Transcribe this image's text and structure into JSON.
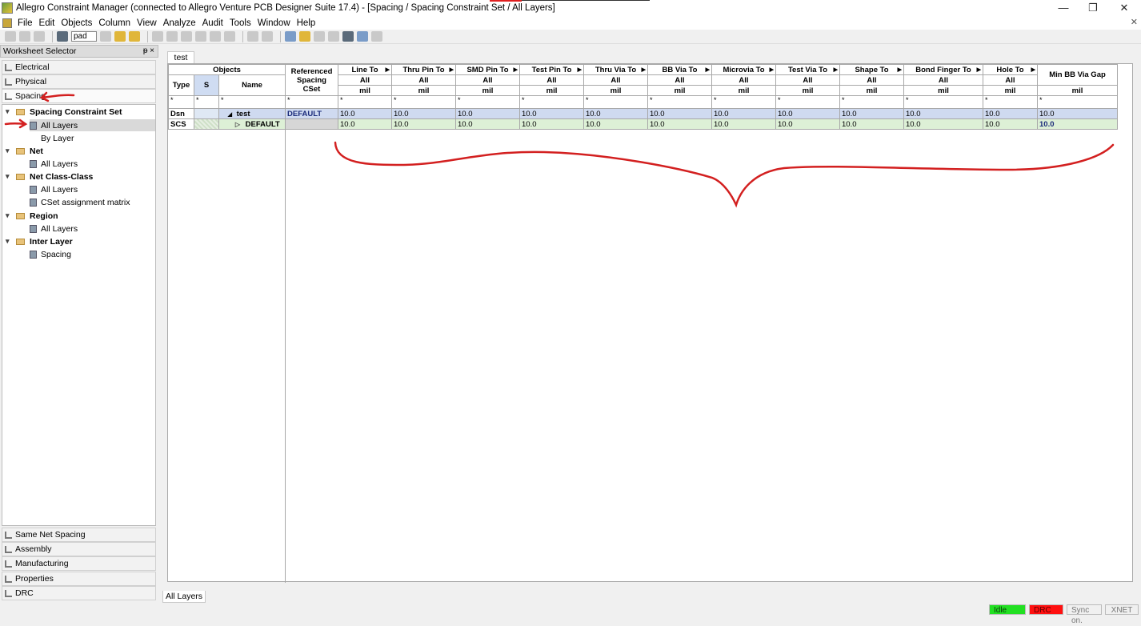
{
  "window": {
    "title": "Allegro Constraint Manager (connected to Allegro Venture PCB Designer Suite 17.4) - [Spacing / Spacing Constraint Set / All Layers]",
    "minimize": "—",
    "restore": "❐",
    "close": "✕"
  },
  "menu": {
    "items": [
      "File",
      "Edit",
      "Objects",
      "Column",
      "View",
      "Analyze",
      "Audit",
      "Tools",
      "Window",
      "Help"
    ],
    "close_doc": "✕"
  },
  "toolbar": {
    "filter_value": "pad"
  },
  "worksheet_selector": {
    "title": "Worksheet Selector",
    "pin": "ᵽ ×",
    "top_tabs": [
      "Electrical",
      "Physical",
      "Spacing"
    ],
    "active_tab": "Spacing",
    "tree": [
      {
        "label": "Spacing Constraint Set",
        "level": 0,
        "bold": true
      },
      {
        "label": "All Layers",
        "level": 1,
        "selected": true
      },
      {
        "label": "By Layer",
        "level": 1
      },
      {
        "label": "Net",
        "level": 0,
        "bold": true
      },
      {
        "label": "All Layers",
        "level": 1
      },
      {
        "label": "Net Class-Class",
        "level": 0,
        "bold": true
      },
      {
        "label": "All Layers",
        "level": 1
      },
      {
        "label": "CSet assignment matrix",
        "level": 1
      },
      {
        "label": "Region",
        "level": 0,
        "bold": true
      },
      {
        "label": "All Layers",
        "level": 1
      },
      {
        "label": "Inter Layer",
        "level": 0,
        "bold": true
      },
      {
        "label": "Spacing",
        "level": 1
      }
    ],
    "bottom_tabs": [
      "Same Net Spacing",
      "Assembly",
      "Manufacturing",
      "Properties",
      "DRC"
    ]
  },
  "document": {
    "tab": "test",
    "bottom_tab": "All Layers"
  },
  "grid": {
    "objects_header": "Objects",
    "type_header": "Type",
    "s_header": "S",
    "name_header": "Name",
    "cset_header": "Referenced Spacing CSet",
    "columns": [
      {
        "label": "Line To",
        "layer": "All",
        "unit": "mil"
      },
      {
        "label": "Thru Pin To",
        "layer": "All",
        "unit": "mil"
      },
      {
        "label": "SMD Pin To",
        "layer": "All",
        "unit": "mil"
      },
      {
        "label": "Test Pin To",
        "layer": "All",
        "unit": "mil"
      },
      {
        "label": "Thru Via To",
        "layer": "All",
        "unit": "mil"
      },
      {
        "label": "BB Via To",
        "layer": "All",
        "unit": "mil"
      },
      {
        "label": "Microvia To",
        "layer": "All",
        "unit": "mil"
      },
      {
        "label": "Test Via To",
        "layer": "All",
        "unit": "mil"
      },
      {
        "label": "Shape To",
        "layer": "All",
        "unit": "mil"
      },
      {
        "label": "Bond Finger To",
        "layer": "All",
        "unit": "mil"
      },
      {
        "label": "Hole To",
        "layer": "All",
        "unit": "mil"
      },
      {
        "label": "Min BB Via Gap",
        "layer": "",
        "unit": "mil"
      }
    ],
    "filter_char": "*",
    "rows": [
      {
        "type": "Dsn",
        "name": "test",
        "expander": "◢",
        "cset": "DEFAULT",
        "values": [
          "10.0",
          "10.0",
          "10.0",
          "10.0",
          "10.0",
          "10.0",
          "10.0",
          "10.0",
          "10.0",
          "10.0",
          "10.0",
          "10.0"
        ]
      },
      {
        "type": "SCS",
        "name": "DEFAULT",
        "expander": "▷",
        "cset": "",
        "values": [
          "10.0",
          "10.0",
          "10.0",
          "10.0",
          "10.0",
          "10.0",
          "10.0",
          "10.0",
          "10.0",
          "10.0",
          "10.0",
          "10.0"
        ]
      }
    ]
  },
  "status": {
    "idle": "Idle",
    "drc": "DRC",
    "sync": "Sync on.",
    "xnet": "XNET"
  },
  "colors": {
    "annotation": "#d32020",
    "dsn_row": "#cfdaf0",
    "scs_row": "#ddf0d6",
    "idle": "#22e022",
    "drc": "#ff1010"
  }
}
